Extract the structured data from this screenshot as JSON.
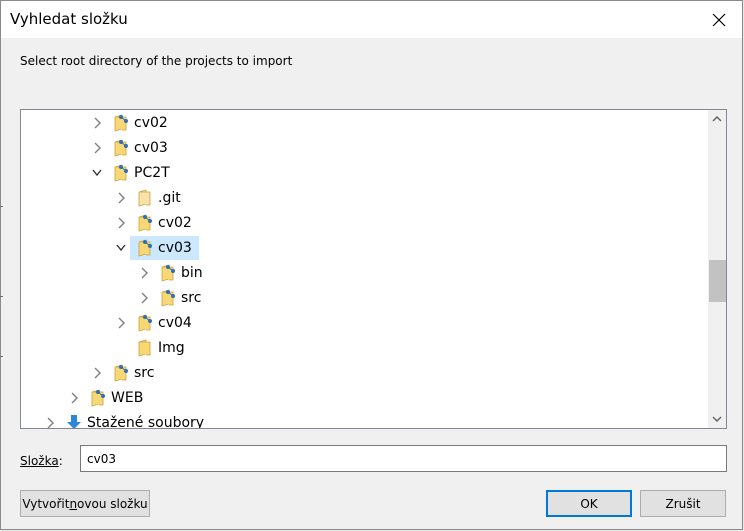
{
  "window": {
    "title": "Vyhledat složku",
    "close_icon": "close-icon"
  },
  "prompt": "Select root directory of the projects to import",
  "tree": {
    "rows": [
      {
        "label": "cv02",
        "level": 4,
        "chevron": "right",
        "icon": "project-folder-icon"
      },
      {
        "label": "cv03",
        "level": 4,
        "chevron": "right",
        "icon": "project-folder-icon"
      },
      {
        "label": "PC2T",
        "level": 4,
        "chevron": "down",
        "icon": "project-folder-icon"
      },
      {
        "label": ".git",
        "level": 5,
        "chevron": "right",
        "icon": "hidden-folder-icon"
      },
      {
        "label": "cv02",
        "level": 5,
        "chevron": "right",
        "icon": "project-folder-icon"
      },
      {
        "label": "cv03",
        "level": 5,
        "chevron": "down",
        "icon": "project-folder-icon",
        "selected": true
      },
      {
        "label": "bin",
        "level": 6,
        "chevron": "right",
        "icon": "project-folder-icon"
      },
      {
        "label": "src",
        "level": 6,
        "chevron": "right",
        "icon": "project-folder-icon"
      },
      {
        "label": "cv04",
        "level": 5,
        "chevron": "right",
        "icon": "project-folder-icon"
      },
      {
        "label": "Img",
        "level": 5,
        "chevron": "none",
        "icon": "folder-icon"
      },
      {
        "label": "src",
        "level": 4,
        "chevron": "right",
        "icon": "project-folder-icon"
      },
      {
        "label": "WEB",
        "level": 3,
        "chevron": "right",
        "icon": "project-folder-icon"
      },
      {
        "label": "Stažené soubory",
        "level": 2,
        "chevron": "right",
        "icon": "downloads-icon"
      }
    ],
    "scroll_position": 0.55
  },
  "folder_field": {
    "label_prefix": "Složka",
    "label_suffix": ":",
    "value": "cv03"
  },
  "buttons": {
    "new_folder_prefix": "Vytvořit ",
    "new_folder_accel": "n",
    "new_folder_suffix": "ovou složku",
    "ok": "OK",
    "cancel": "Zrušit"
  },
  "colors": {
    "selection": "#cce8ff",
    "ok_border": "#0078d7",
    "folder_yellow": "#f8d775",
    "project_blue": "#2f6fb5"
  }
}
